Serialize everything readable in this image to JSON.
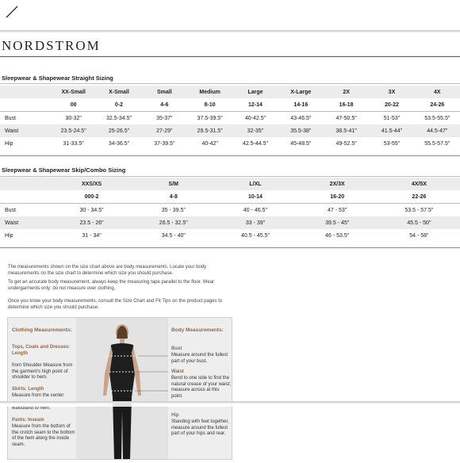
{
  "brand": "NORDSTROM",
  "straight": {
    "title": "Sleepwear & Shapewear Straight Sizing",
    "sizes": [
      "XX-Small",
      "X-Small",
      "Small",
      "Medium",
      "Large",
      "X-Large",
      "2X",
      "3X",
      "4X"
    ],
    "numbers": [
      "00",
      "0-2",
      "4-6",
      "8-10",
      "12-14",
      "14-16",
      "16-18",
      "20-22",
      "24-26"
    ],
    "rows": [
      {
        "label": "Bust",
        "values": [
          "30-32\"",
          "32.5-34.5\"",
          "35-37\"",
          "37.5-39.5\"",
          "40-42.5\"",
          "43-46.5\"",
          "47-50.5\"",
          "51-53\"",
          "53.5-55.5\""
        ]
      },
      {
        "label": "Waist",
        "values": [
          "23.5-24.5\"",
          "25-26.5\"",
          "27-29\"",
          "29.5-31.5\"",
          "32-35\"",
          "35.5-38\"",
          "38.5-41\"",
          "41.5-44\"",
          "44.5-47\""
        ]
      },
      {
        "label": "Hip",
        "values": [
          "31-33.5\"",
          "34-36.5\"",
          "37-39.5\"",
          "40-42\"",
          "42.5-44.5\"",
          "45-48.5\"",
          "49-52.5\"",
          "53-55\"",
          "55.5-57.5\""
        ]
      }
    ]
  },
  "combo": {
    "title": "Sleepwear & Shapewear Skip/Combo Sizing",
    "sizes": [
      "XXS/XS",
      "S/M",
      "L/XL",
      "2X/3X",
      "4X/5X"
    ],
    "numbers": [
      "000-2",
      "4-8",
      "10-14",
      "16-20",
      "22-26"
    ],
    "rows": [
      {
        "label": "Bust",
        "values": [
          "30 - 34.5\"",
          "35 - 39.5\"",
          "40 - 46.5\"",
          "47 - 53\"",
          "53.5 - 57.5\""
        ]
      },
      {
        "label": "Waist",
        "values": [
          "23.5 - 26\"",
          "26.5 - 32.5\"",
          "33 - 39\"",
          "39.5 - 45\"",
          "45.5 - 50\""
        ]
      },
      {
        "label": "Hip",
        "values": [
          "31 - 34\"",
          "34.5 - 40\"",
          "40.5 - 45.5\"",
          "46 - 53.5\"",
          "54 - 58\""
        ]
      }
    ]
  },
  "notes": {
    "p1": "The measurements shown on the size chart above are body measurements. Locate your body measurements on the size chart to determine which size you should purchase.",
    "p2": "To get an accurate body measurement, always keep the measuring tape parallel to the floor. Wear undergarments only; do not measure over clothing.",
    "p3": "Once you know your body measurements, consult the Size Chart and Fit Tips on the product pages to determine which size you should purchase."
  },
  "figure": {
    "clothing_heading": "Clothing Measurements:",
    "tops_title": "Tops, Coats and Dresses: Length",
    "tops_text": "from Shoulder Measure from the garment's high point of shoulder to hem.",
    "skirts_title": "Skirts: Length",
    "skirts_text": "Measure from the center",
    "skirts_tail": "waistband to hem.",
    "pants_title": "Pants: Inseam",
    "pants_text": "Measure from the bottom of the crotch seam to the bottom of the hem along the inside seam.",
    "body_heading": "Body Measurements:",
    "bust_title": "Bust",
    "bust_text": "Measure around the fullest part of your bust.",
    "waist_title": "Waist",
    "waist_text": "Bend to one side to find the natural crease of your waist; measure across at this point.",
    "hip_title": "Hip",
    "hip_text": "Standing with feet together, measure around the fullest part of your hips and rear."
  }
}
